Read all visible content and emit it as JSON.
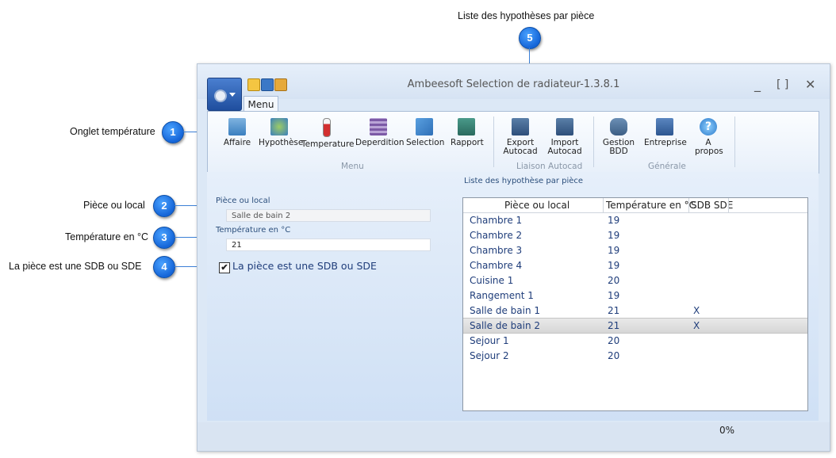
{
  "callouts": [
    {
      "num": "1",
      "label": "Onglet température"
    },
    {
      "num": "2",
      "label": "Pièce ou local"
    },
    {
      "num": "3",
      "label": "Température en °C"
    },
    {
      "num": "4",
      "label": "La pièce est une SDB ou SDE"
    },
    {
      "num": "5",
      "label": "Liste des hypothèses par pièce"
    }
  ],
  "window": {
    "title": "Ambeesoft Selection de radiateur-1.3.8.1",
    "controls": {
      "minimize": "_",
      "maximize": "[ ]",
      "close": "✕"
    },
    "tab": "Menu"
  },
  "ribbon": {
    "buttons": [
      {
        "label": "Affaire",
        "icon": "briefcase-icon"
      },
      {
        "label": "Hypothèse",
        "icon": "gears-icon"
      },
      {
        "label": "Temperature",
        "icon": "thermometer-icon"
      },
      {
        "label": "Deperdition",
        "icon": "wall-icon"
      },
      {
        "label": "Selection",
        "icon": "cursor-select-icon"
      },
      {
        "label": "Rapport",
        "icon": "report-icon"
      },
      {
        "label": "Export Autocad",
        "icon": "export-autocad-icon"
      },
      {
        "label": "Import Autocad",
        "icon": "import-autocad-icon"
      },
      {
        "label": "Gestion BDD",
        "icon": "database-icon"
      },
      {
        "label": "Entreprise",
        "icon": "building-icon"
      },
      {
        "label": "A propos",
        "icon": "help-icon"
      }
    ],
    "groups": [
      "Menu",
      "Liaison Autocad",
      "Générale"
    ]
  },
  "form": {
    "room_label": "Pièce ou local",
    "room_value": "Salle de bain 2",
    "temp_label": "Température en °C",
    "temp_value": "21",
    "sdb_checked": "✔",
    "sdb_label": "La pièce est une SDB ou SDE"
  },
  "list": {
    "caption": "Liste des hypothèse par pièce",
    "columns": [
      "Pièce ou local",
      "Température en °C",
      "SDB SDE"
    ],
    "rows": [
      [
        "Chambre 1",
        "19",
        ""
      ],
      [
        "Chambre 2",
        "19",
        ""
      ],
      [
        "Chambre 3",
        "19",
        ""
      ],
      [
        "Chambre 4",
        "19",
        ""
      ],
      [
        "Cuisine 1",
        "20",
        ""
      ],
      [
        "Rangement 1",
        "19",
        ""
      ],
      [
        "Salle de bain 1",
        "21",
        "X"
      ],
      [
        "Salle de bain 2",
        "21",
        "X"
      ],
      [
        "Sejour 1",
        "20",
        ""
      ],
      [
        "Sejour 2",
        "20",
        ""
      ]
    ],
    "selected_row": "Salle de bain 2"
  },
  "status": {
    "progress": "0%"
  }
}
